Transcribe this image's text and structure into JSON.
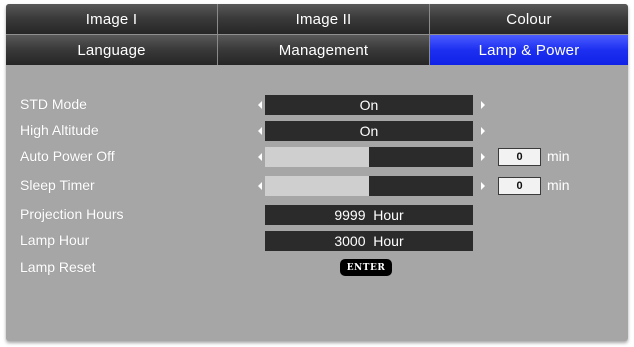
{
  "tabs_row1": [
    {
      "label": "Image I",
      "active": false
    },
    {
      "label": "Image II",
      "active": false
    },
    {
      "label": "Colour",
      "active": false
    }
  ],
  "tabs_row2": [
    {
      "label": "Language",
      "active": false
    },
    {
      "label": "Management",
      "active": false
    },
    {
      "label": "Lamp & Power",
      "active": true
    }
  ],
  "settings": {
    "std_mode": {
      "label": "STD Mode",
      "value": "On"
    },
    "high_altitude": {
      "label": "High Altitude",
      "value": "On"
    },
    "auto_power_off": {
      "label": "Auto Power Off",
      "level": 0.5,
      "value": "0",
      "unit": "min"
    },
    "sleep_timer": {
      "label": "Sleep Timer",
      "level": 0.5,
      "value": "0",
      "unit": "min"
    },
    "projection_hours": {
      "label": "Projection Hours",
      "value": "9999  Hour"
    },
    "lamp_hour": {
      "label": "Lamp Hour",
      "value": "3000  Hour"
    },
    "lamp_reset": {
      "label": "Lamp Reset",
      "button": "ENTER"
    }
  },
  "colors": {
    "active_tab": "#1d2ff0",
    "tab_bg": "#3b3b3b",
    "panel_bg": "#a6a6a6",
    "value_box": "#2b2b2b",
    "slider_fill": "#cfcfcf"
  }
}
